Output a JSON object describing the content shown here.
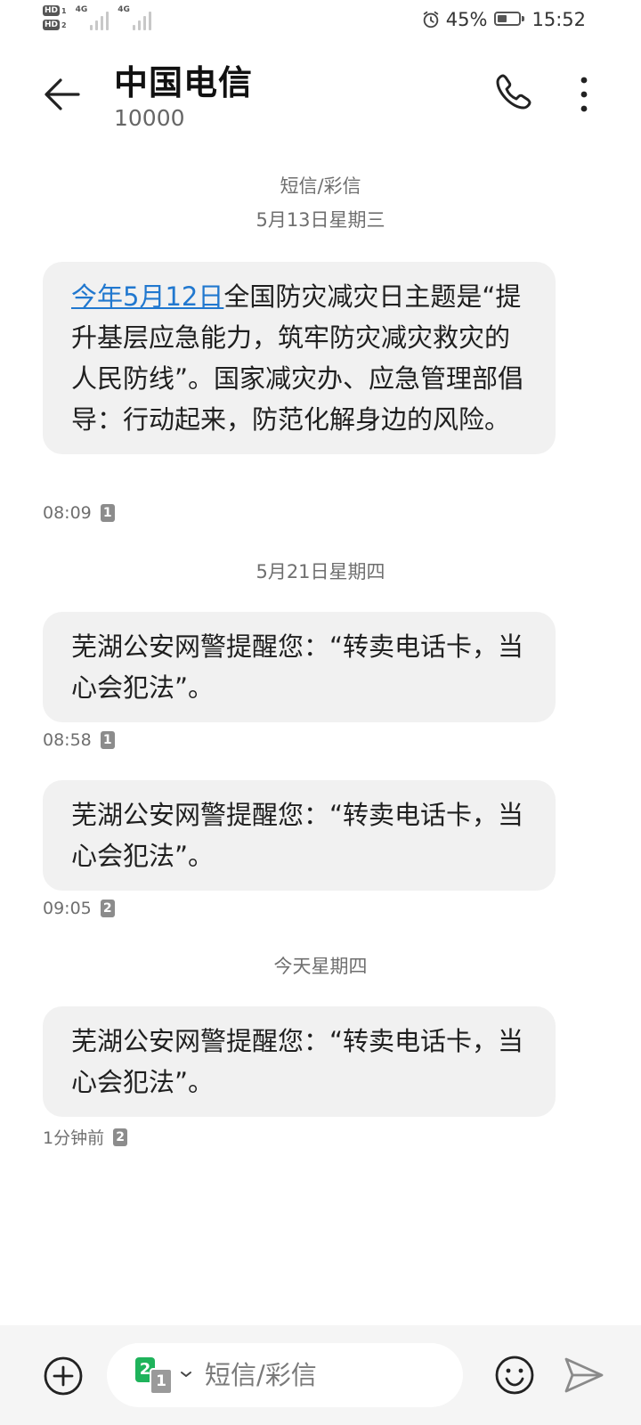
{
  "status_bar": {
    "hd1": "HD",
    "hd1_num": "1",
    "hd2": "HD",
    "hd2_num": "2",
    "net1": "4G",
    "net2": "4G",
    "battery_percent": "45%",
    "battery_level": 0.45,
    "time": "15:52",
    "icons": [
      "alarm-icon",
      "battery-icon",
      "signal-icon"
    ]
  },
  "header": {
    "title": "中国电信",
    "number": "10000",
    "icons": [
      "back-arrow-icon",
      "phone-icon",
      "more-vertical-icon"
    ]
  },
  "conversation": {
    "type_label": "短信/彩信",
    "groups": [
      {
        "date": "5月13日星期三",
        "messages": [
          {
            "link": "今年5月12日",
            "text": "全国防灾减灾日主题是“提升基层应急能力，筑牢防灾减灾救灾的人民防线”。国家减灾办、应急管理部倡导：行动起来，防范化解身边的风险。",
            "time": "08:09",
            "sim": "1"
          }
        ]
      },
      {
        "date": "5月21日星期四",
        "messages": [
          {
            "text": "芜湖公安网警提醒您：“转卖电话卡，当心会犯法”。",
            "time": "08:58",
            "sim": "1"
          },
          {
            "text": "芜湖公安网警提醒您：“转卖电话卡，当心会犯法”。",
            "time": "09:05",
            "sim": "2"
          }
        ]
      },
      {
        "date": "今天星期四",
        "messages": [
          {
            "text": "芜湖公安网警提醒您：“转卖电话卡，当心会犯法”。",
            "time": "1分钟前",
            "sim": "2"
          }
        ]
      }
    ]
  },
  "composer": {
    "placeholder": "短信/彩信",
    "sim_primary": "2",
    "sim_secondary": "1",
    "icons": [
      "add-circle-icon",
      "emoji-icon",
      "send-icon",
      "chevron-down-icon"
    ]
  },
  "colors": {
    "link": "#2178cf",
    "bubble": "#f1f1f1",
    "sim_active": "#1fb35b",
    "bottom_bar": "#f5f5f5"
  }
}
